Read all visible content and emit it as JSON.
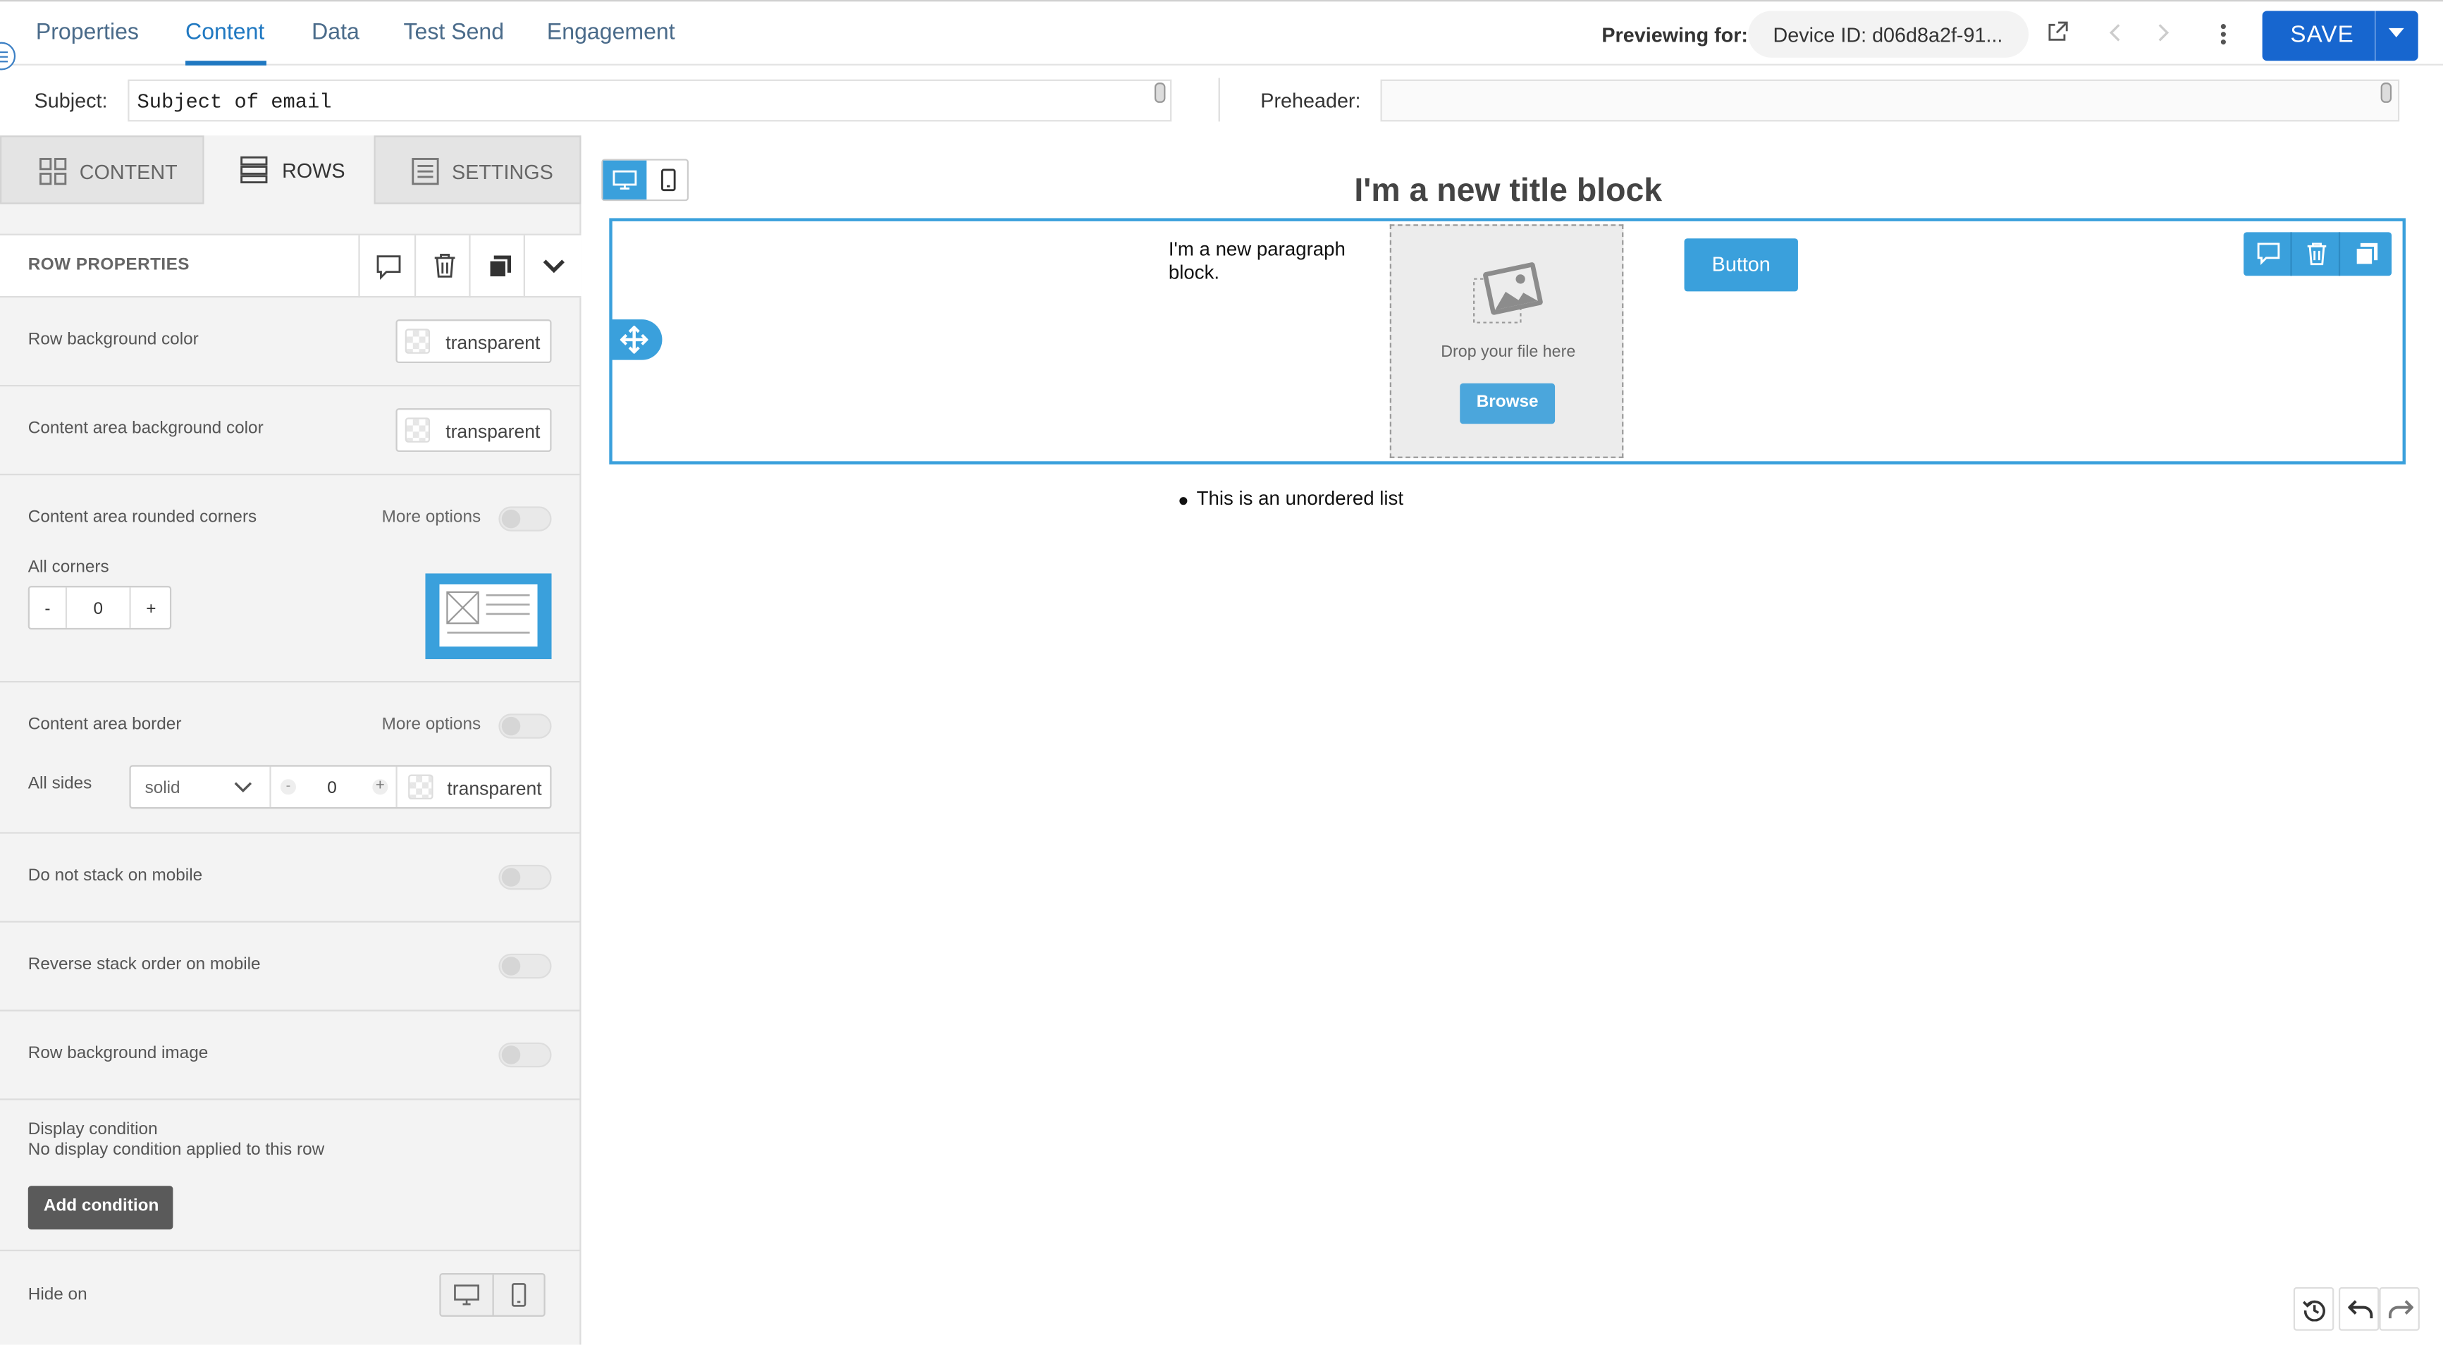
{
  "nav": {
    "tabs": [
      "Properties",
      "Content",
      "Data",
      "Test Send",
      "Engagement"
    ],
    "active_tab": "Content",
    "previewing_label": "Previewing for:",
    "device_id": "Device ID: d06d8a2f-91...",
    "save_label": "SAVE"
  },
  "subject": {
    "label": "Subject:",
    "value": "Subject of email"
  },
  "preheader": {
    "label": "Preheader:",
    "value": ""
  },
  "panel_tabs": {
    "content": "CONTENT",
    "rows": "ROWS",
    "settings": "SETTINGS",
    "active": "ROWS"
  },
  "row_properties": {
    "title": "ROW PROPERTIES",
    "row_bg_label": "Row background color",
    "row_bg_value": "transparent",
    "content_bg_label": "Content area background color",
    "content_bg_value": "transparent",
    "rounded_label": "Content area rounded corners",
    "more_options": "More options",
    "all_corners_label": "All corners",
    "corners_minus": "-",
    "corners_value": "0",
    "corners_plus": "+",
    "border_label": "Content area border",
    "all_sides_label": "All sides",
    "border_style": "solid",
    "border_width": "0",
    "border_color": "transparent",
    "no_stack_label": "Do not stack on mobile",
    "reverse_label": "Reverse stack order on mobile",
    "bg_image_label": "Row background image",
    "display_condition_label": "Display condition",
    "display_condition_text": "No display condition applied to this row",
    "add_condition": "Add condition",
    "hide_on_label": "Hide on"
  },
  "canvas": {
    "title_block": "I'm a new title block",
    "paragraph": "I'm a new paragraph block.",
    "drop_text": "Drop your file here",
    "browse": "Browse",
    "button": "Button",
    "list_item": "This is an unordered list"
  },
  "colors": {
    "accent": "#3aa0dc",
    "save": "#1766cf",
    "link": "#1f78c1"
  }
}
